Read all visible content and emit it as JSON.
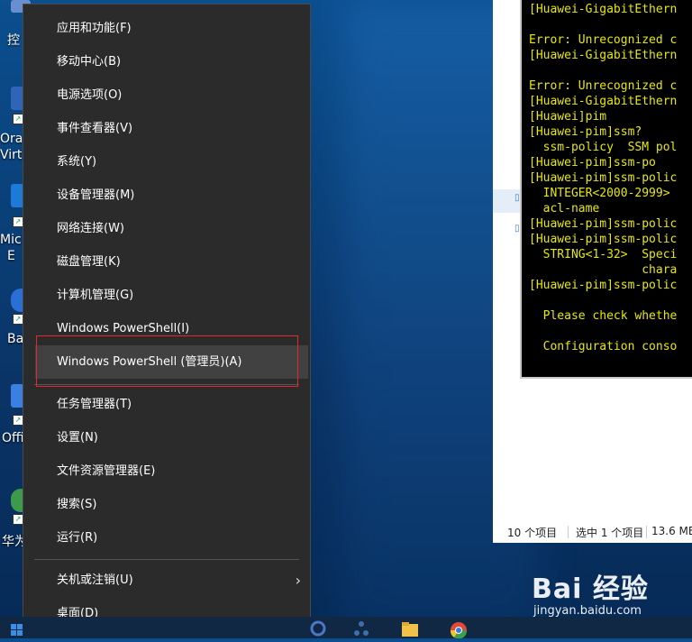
{
  "desktop": {
    "icons": [
      {
        "label": "控",
        "name": "desktop-icon-control-panel",
        "color": "#6a8fd0"
      },
      {
        "label": "Ora",
        "label2": "Virt",
        "name": "desktop-icon-oracle-virtualbox",
        "color": "#2f64b6"
      },
      {
        "label": "Mic",
        "label2": "E",
        "name": "desktop-icon-microsoft-edge",
        "color": "#1e7ad8"
      },
      {
        "label": "Ba",
        "name": "desktop-icon-baidu",
        "color": "#2a6fd6"
      },
      {
        "label": "Offi",
        "name": "desktop-icon-office",
        "color": "#3b7fe0"
      },
      {
        "label": "华为",
        "name": "desktop-icon-huawei",
        "color": "#3c9a4a"
      }
    ]
  },
  "terminal": {
    "lines": [
      "[Huawei-GigabitEthern",
      "",
      "Error: Unrecognized c",
      "[Huawei-GigabitEthern",
      "",
      "Error: Unrecognized c",
      "[Huawei-GigabitEthern",
      "[Huawei]pim",
      "[Huawei-pim]ssm?",
      "  ssm-policy  SSM pol",
      "[Huawei-pim]ssm-po",
      "[Huawei-pim]ssm-polic",
      "  INTEGER<2000-2999>",
      "  acl-name",
      "[Huawei-pim]ssm-polic",
      "[Huawei-pim]ssm-polic",
      "  STRING<1-32>  Speci",
      "                chara",
      "[Huawei-pim]ssm-polic",
      "",
      "  Please check whethe",
      "",
      "  Configuration conso"
    ],
    "text_color": "#e8e800"
  },
  "explorer": {
    "status_items": "10 个项目",
    "status_selected": "选中 1 个项目",
    "status_size": "13.6 MB"
  },
  "menu": {
    "items": [
      {
        "label": "应用和功能(F)",
        "name": "menu-item-apps-features"
      },
      {
        "label": "移动中心(B)",
        "name": "menu-item-mobility-center"
      },
      {
        "label": "电源选项(O)",
        "name": "menu-item-power-options"
      },
      {
        "label": "事件查看器(V)",
        "name": "menu-item-event-viewer"
      },
      {
        "label": "系统(Y)",
        "name": "menu-item-system"
      },
      {
        "label": "设备管理器(M)",
        "name": "menu-item-device-manager"
      },
      {
        "label": "网络连接(W)",
        "name": "menu-item-network-connections"
      },
      {
        "label": "磁盘管理(K)",
        "name": "menu-item-disk-management"
      },
      {
        "label": "计算机管理(G)",
        "name": "menu-item-computer-management"
      },
      {
        "label": "Windows PowerShell(I)",
        "name": "menu-item-powershell"
      },
      {
        "label": "Windows PowerShell (管理员)(A)",
        "name": "menu-item-powershell-admin"
      },
      {
        "label": "任务管理器(T)",
        "name": "menu-item-task-manager"
      },
      {
        "label": "设置(N)",
        "name": "menu-item-settings"
      },
      {
        "label": "文件资源管理器(E)",
        "name": "menu-item-file-explorer"
      },
      {
        "label": "搜索(S)",
        "name": "menu-item-search"
      },
      {
        "label": "运行(R)",
        "name": "menu-item-run"
      },
      {
        "label": "关机或注销(U)",
        "name": "menu-item-shutdown-signout"
      },
      {
        "label": "桌面(D)",
        "name": "menu-item-desktop"
      }
    ],
    "hovered_index": 10,
    "submenu_arrow": "›"
  },
  "taskbar": {
    "icons": [
      {
        "name": "start-icon",
        "color": "#3a8ee6"
      },
      {
        "name": "virtualbox-taskbar-icon",
        "color": "#4a78c8"
      },
      {
        "name": "network-taskbar-icon",
        "color": "#3c6fb0"
      },
      {
        "name": "file-explorer-taskbar-icon",
        "color": "#f0c24a"
      },
      {
        "name": "chrome-taskbar-icon",
        "color": "#e04a3a"
      }
    ]
  },
  "watermark": {
    "logo": "Bai 经验",
    "url": "jingyan.baidu.com"
  },
  "colors": {
    "menu_bg": "#2b2b2b",
    "menu_hover": "#414141",
    "highlight_box": "#e0282e"
  }
}
